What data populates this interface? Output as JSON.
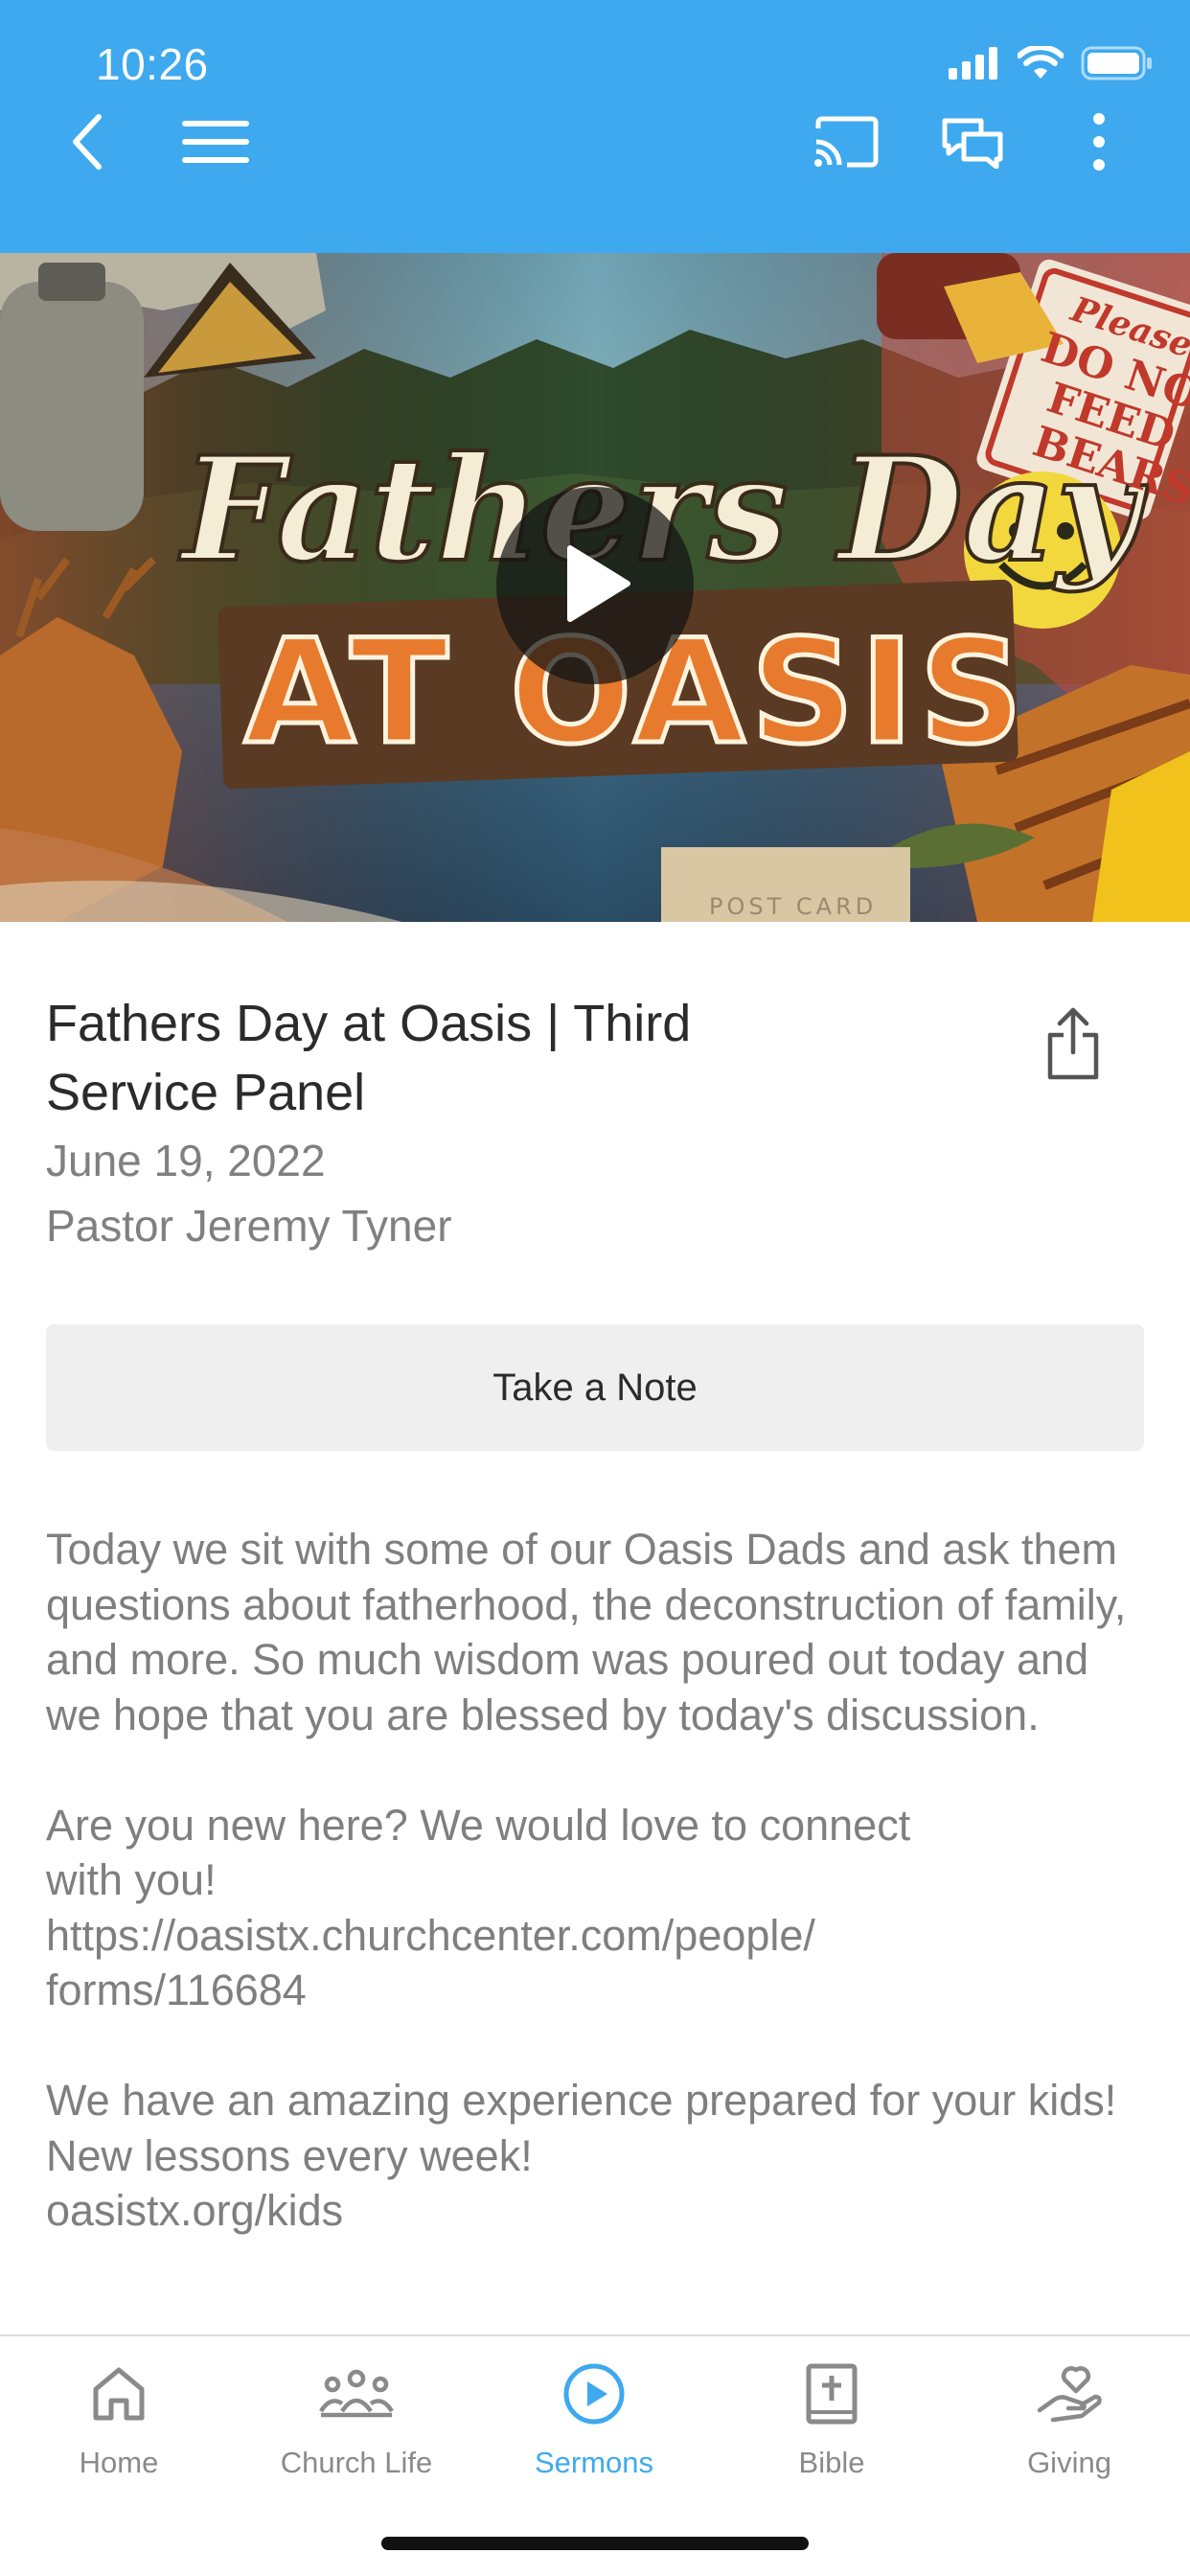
{
  "status_bar": {
    "time": "10:26"
  },
  "toolbar": {
    "back_icon": "chevron-left-icon",
    "menu_icon": "hamburger-menu-icon",
    "cast_icon": "cast-icon",
    "chat_icon": "chat-bubbles-icon",
    "more_icon": "more-vertical-icon",
    "color": "#3ea9ef"
  },
  "hero": {
    "title_line1": "Fathers Day",
    "title_line2": "AT OASIS",
    "sign_text": [
      "Please",
      "DO NOT",
      "FEED",
      "BEARS"
    ],
    "postcard_text": "POST CARD",
    "play_icon": "play-icon"
  },
  "sermon": {
    "title": "Fathers Day at Oasis | Third Service Panel",
    "date": "June 19, 2022",
    "speaker": "Pastor Jeremy Tyner",
    "share_icon": "share-icon",
    "note_button": "Take a Note",
    "description": [
      "Today we sit with some of our Oasis Dads and ask them questions about fatherhood, the deconstruction of family, and more.  So much wisdom was poured out today and we hope that you are blessed by today's discussion.",
      "Are you new here? We would love to connect\nwith you!\nhttps://oasistx.churchcenter.com/people/\nforms/116684",
      "We have an amazing experience prepared for your kids! New lessons every week!\noasistx.org/kids"
    ]
  },
  "tabs": [
    {
      "label": "Home",
      "icon": "home-icon",
      "active": false
    },
    {
      "label": "Church Life",
      "icon": "people-group-icon",
      "active": false
    },
    {
      "label": "Sermons",
      "icon": "play-circle-icon",
      "active": true
    },
    {
      "label": "Bible",
      "icon": "bible-icon",
      "active": false
    },
    {
      "label": "Giving",
      "icon": "giving-hand-icon",
      "active": false
    }
  ],
  "colors": {
    "accent": "#3ea9ef",
    "inactive": "#8a8a8a"
  }
}
